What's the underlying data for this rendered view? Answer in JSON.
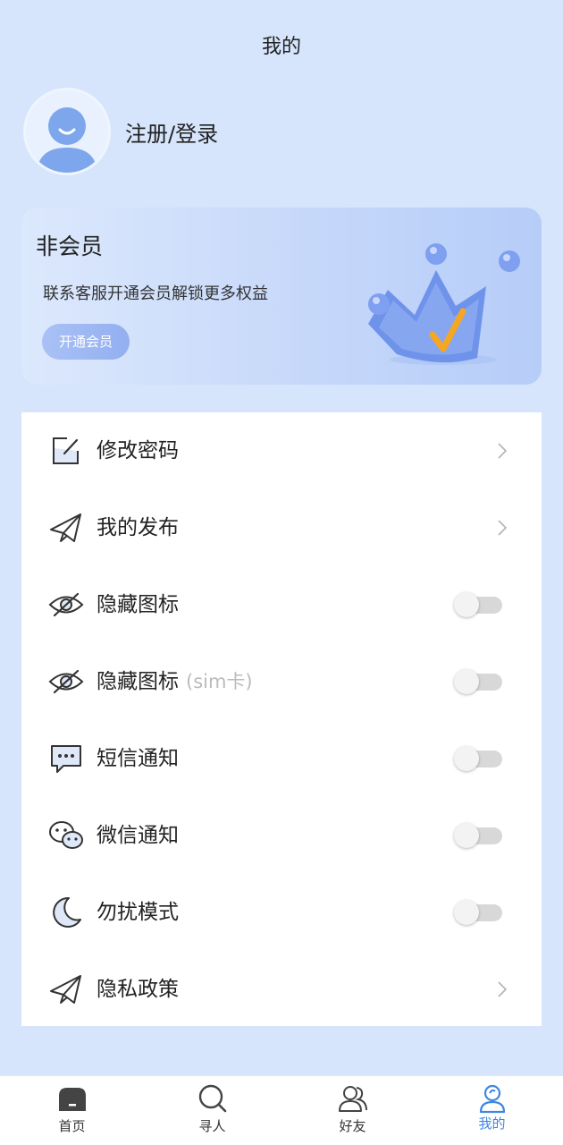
{
  "header": {
    "title": "我的"
  },
  "profile": {
    "login_label": "注册/登录"
  },
  "vip": {
    "title": "非会员",
    "desc": "联系客服开通会员解锁更多权益",
    "button": "开通会员",
    "accent": "#93aff0"
  },
  "menu": {
    "change_password": "修改密码",
    "my_posts": "我的发布",
    "hide_icon": "隐藏图标",
    "hide_icon_sim": "隐藏图标",
    "hide_icon_sim_suffix": "(sim卡)",
    "sms_notify": "短信通知",
    "wechat_notify": "微信通知",
    "dnd_mode": "勿扰模式",
    "privacy": "隐私政策",
    "toggles": {
      "hide_icon": false,
      "hide_icon_sim": false,
      "sms_notify": false,
      "wechat_notify": false,
      "dnd_mode": false
    }
  },
  "tabs": {
    "home": "首页",
    "search": "寻人",
    "friends": "好友",
    "mine": "我的",
    "active_color": "#3f86e3"
  }
}
